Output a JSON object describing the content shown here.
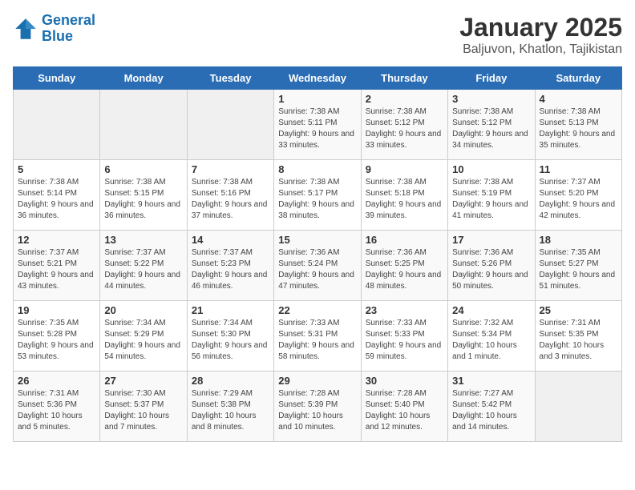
{
  "header": {
    "logo_line1": "General",
    "logo_line2": "Blue",
    "title": "January 2025",
    "subtitle": "Baljuvon, Khatlon, Tajikistan"
  },
  "weekdays": [
    "Sunday",
    "Monday",
    "Tuesday",
    "Wednesday",
    "Thursday",
    "Friday",
    "Saturday"
  ],
  "weeks": [
    [
      {
        "day": "",
        "sunrise": "",
        "sunset": "",
        "daylight": ""
      },
      {
        "day": "",
        "sunrise": "",
        "sunset": "",
        "daylight": ""
      },
      {
        "day": "",
        "sunrise": "",
        "sunset": "",
        "daylight": ""
      },
      {
        "day": "1",
        "sunrise": "Sunrise: 7:38 AM",
        "sunset": "Sunset: 5:11 PM",
        "daylight": "Daylight: 9 hours and 33 minutes."
      },
      {
        "day": "2",
        "sunrise": "Sunrise: 7:38 AM",
        "sunset": "Sunset: 5:12 PM",
        "daylight": "Daylight: 9 hours and 33 minutes."
      },
      {
        "day": "3",
        "sunrise": "Sunrise: 7:38 AM",
        "sunset": "Sunset: 5:12 PM",
        "daylight": "Daylight: 9 hours and 34 minutes."
      },
      {
        "day": "4",
        "sunrise": "Sunrise: 7:38 AM",
        "sunset": "Sunset: 5:13 PM",
        "daylight": "Daylight: 9 hours and 35 minutes."
      }
    ],
    [
      {
        "day": "5",
        "sunrise": "Sunrise: 7:38 AM",
        "sunset": "Sunset: 5:14 PM",
        "daylight": "Daylight: 9 hours and 36 minutes."
      },
      {
        "day": "6",
        "sunrise": "Sunrise: 7:38 AM",
        "sunset": "Sunset: 5:15 PM",
        "daylight": "Daylight: 9 hours and 36 minutes."
      },
      {
        "day": "7",
        "sunrise": "Sunrise: 7:38 AM",
        "sunset": "Sunset: 5:16 PM",
        "daylight": "Daylight: 9 hours and 37 minutes."
      },
      {
        "day": "8",
        "sunrise": "Sunrise: 7:38 AM",
        "sunset": "Sunset: 5:17 PM",
        "daylight": "Daylight: 9 hours and 38 minutes."
      },
      {
        "day": "9",
        "sunrise": "Sunrise: 7:38 AM",
        "sunset": "Sunset: 5:18 PM",
        "daylight": "Daylight: 9 hours and 39 minutes."
      },
      {
        "day": "10",
        "sunrise": "Sunrise: 7:38 AM",
        "sunset": "Sunset: 5:19 PM",
        "daylight": "Daylight: 9 hours and 41 minutes."
      },
      {
        "day": "11",
        "sunrise": "Sunrise: 7:37 AM",
        "sunset": "Sunset: 5:20 PM",
        "daylight": "Daylight: 9 hours and 42 minutes."
      }
    ],
    [
      {
        "day": "12",
        "sunrise": "Sunrise: 7:37 AM",
        "sunset": "Sunset: 5:21 PM",
        "daylight": "Daylight: 9 hours and 43 minutes."
      },
      {
        "day": "13",
        "sunrise": "Sunrise: 7:37 AM",
        "sunset": "Sunset: 5:22 PM",
        "daylight": "Daylight: 9 hours and 44 minutes."
      },
      {
        "day": "14",
        "sunrise": "Sunrise: 7:37 AM",
        "sunset": "Sunset: 5:23 PM",
        "daylight": "Daylight: 9 hours and 46 minutes."
      },
      {
        "day": "15",
        "sunrise": "Sunrise: 7:36 AM",
        "sunset": "Sunset: 5:24 PM",
        "daylight": "Daylight: 9 hours and 47 minutes."
      },
      {
        "day": "16",
        "sunrise": "Sunrise: 7:36 AM",
        "sunset": "Sunset: 5:25 PM",
        "daylight": "Daylight: 9 hours and 48 minutes."
      },
      {
        "day": "17",
        "sunrise": "Sunrise: 7:36 AM",
        "sunset": "Sunset: 5:26 PM",
        "daylight": "Daylight: 9 hours and 50 minutes."
      },
      {
        "day": "18",
        "sunrise": "Sunrise: 7:35 AM",
        "sunset": "Sunset: 5:27 PM",
        "daylight": "Daylight: 9 hours and 51 minutes."
      }
    ],
    [
      {
        "day": "19",
        "sunrise": "Sunrise: 7:35 AM",
        "sunset": "Sunset: 5:28 PM",
        "daylight": "Daylight: 9 hours and 53 minutes."
      },
      {
        "day": "20",
        "sunrise": "Sunrise: 7:34 AM",
        "sunset": "Sunset: 5:29 PM",
        "daylight": "Daylight: 9 hours and 54 minutes."
      },
      {
        "day": "21",
        "sunrise": "Sunrise: 7:34 AM",
        "sunset": "Sunset: 5:30 PM",
        "daylight": "Daylight: 9 hours and 56 minutes."
      },
      {
        "day": "22",
        "sunrise": "Sunrise: 7:33 AM",
        "sunset": "Sunset: 5:31 PM",
        "daylight": "Daylight: 9 hours and 58 minutes."
      },
      {
        "day": "23",
        "sunrise": "Sunrise: 7:33 AM",
        "sunset": "Sunset: 5:33 PM",
        "daylight": "Daylight: 9 hours and 59 minutes."
      },
      {
        "day": "24",
        "sunrise": "Sunrise: 7:32 AM",
        "sunset": "Sunset: 5:34 PM",
        "daylight": "Daylight: 10 hours and 1 minute."
      },
      {
        "day": "25",
        "sunrise": "Sunrise: 7:31 AM",
        "sunset": "Sunset: 5:35 PM",
        "daylight": "Daylight: 10 hours and 3 minutes."
      }
    ],
    [
      {
        "day": "26",
        "sunrise": "Sunrise: 7:31 AM",
        "sunset": "Sunset: 5:36 PM",
        "daylight": "Daylight: 10 hours and 5 minutes."
      },
      {
        "day": "27",
        "sunrise": "Sunrise: 7:30 AM",
        "sunset": "Sunset: 5:37 PM",
        "daylight": "Daylight: 10 hours and 7 minutes."
      },
      {
        "day": "28",
        "sunrise": "Sunrise: 7:29 AM",
        "sunset": "Sunset: 5:38 PM",
        "daylight": "Daylight: 10 hours and 8 minutes."
      },
      {
        "day": "29",
        "sunrise": "Sunrise: 7:28 AM",
        "sunset": "Sunset: 5:39 PM",
        "daylight": "Daylight: 10 hours and 10 minutes."
      },
      {
        "day": "30",
        "sunrise": "Sunrise: 7:28 AM",
        "sunset": "Sunset: 5:40 PM",
        "daylight": "Daylight: 10 hours and 12 minutes."
      },
      {
        "day": "31",
        "sunrise": "Sunrise: 7:27 AM",
        "sunset": "Sunset: 5:42 PM",
        "daylight": "Daylight: 10 hours and 14 minutes."
      },
      {
        "day": "",
        "sunrise": "",
        "sunset": "",
        "daylight": ""
      }
    ]
  ]
}
